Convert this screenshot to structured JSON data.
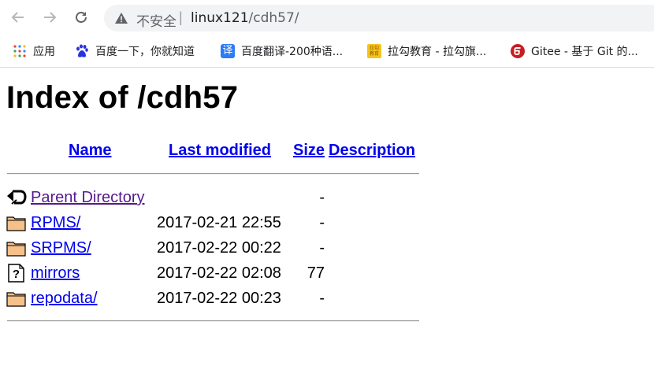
{
  "browser": {
    "insecure_label": "不安全",
    "separator": "|",
    "url_host": "linux121",
    "url_path": "/cdh57/"
  },
  "bookmarks": [
    {
      "label": "应用",
      "icon": "apps-grid-icon"
    },
    {
      "label": "百度一下，你就知道",
      "icon": "baidu-paw-icon"
    },
    {
      "label": "百度翻译-200种语...",
      "icon": "translate-icon"
    },
    {
      "label": "拉勾教育 - 拉勾旗...",
      "icon": "lagou-icon"
    },
    {
      "label": "Gitee - 基于 Git 的...",
      "icon": "gitee-icon"
    }
  ],
  "page": {
    "title": "Index of /cdh57",
    "headers": {
      "name": "Name",
      "modified": "Last modified",
      "size": "Size",
      "description": "Description"
    },
    "rows": [
      {
        "name": "Parent Directory",
        "date": "",
        "size": "-",
        "icon": "back-arrow-icon"
      },
      {
        "name": "RPMS/",
        "date": "2017-02-21 22:55",
        "size": "-",
        "icon": "folder-icon"
      },
      {
        "name": "SRPMS/",
        "date": "2017-02-22 00:22",
        "size": "-",
        "icon": "folder-icon"
      },
      {
        "name": "mirrors",
        "date": "2017-02-22 02:08",
        "size": "77",
        "icon": "unknown-file-icon"
      },
      {
        "name": "repodata/",
        "date": "2017-02-22 00:23",
        "size": "-",
        "icon": "folder-icon"
      }
    ]
  },
  "colors": {
    "link": "#0000ee",
    "visited": "#551a8b",
    "omnibox_bg": "#f1f3f4"
  }
}
